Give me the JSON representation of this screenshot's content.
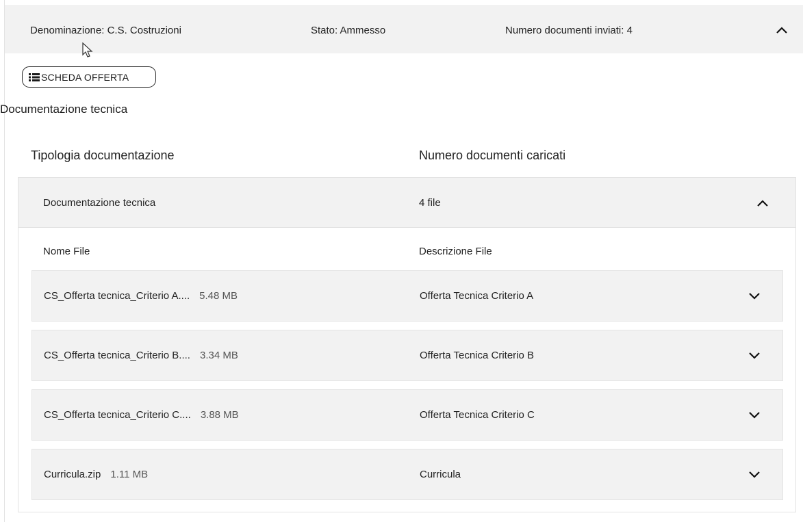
{
  "header": {
    "name": "Denominazione: C.S. Costruzioni",
    "state": "Stato: Ammesso",
    "docs_sent": "Numero documenti inviati: 4"
  },
  "offer_button": {
    "label": "SCHEDA OFFERTA",
    "icon": "list-icon"
  },
  "section_title": "Documentazione tecnica",
  "columns": {
    "type": "Tipologia documentazione",
    "count": "Numero documenti caricati"
  },
  "group": {
    "type": "Documentazione tecnica",
    "count": "4 file",
    "sub_columns": {
      "file_name": "Nome File",
      "file_desc": "Descrizione File"
    },
    "files": [
      {
        "name": "CS_Offerta tecnica_Criterio A....",
        "size": "5.48 MB",
        "description": "Offerta Tecnica Criterio A"
      },
      {
        "name": "CS_Offerta tecnica_Criterio B....",
        "size": "3.34 MB",
        "description": "Offerta Tecnica Criterio B"
      },
      {
        "name": "CS_Offerta tecnica_Criterio C....",
        "size": "3.88 MB",
        "description": "Offerta Tecnica Criterio C"
      },
      {
        "name": "Curricula.zip",
        "size": "1.11 MB",
        "description": "Curricula"
      }
    ]
  },
  "icons": {
    "collapse": "chevron-up-icon",
    "expand": "chevron-down-icon",
    "cursor": "mouse-cursor-icon"
  }
}
